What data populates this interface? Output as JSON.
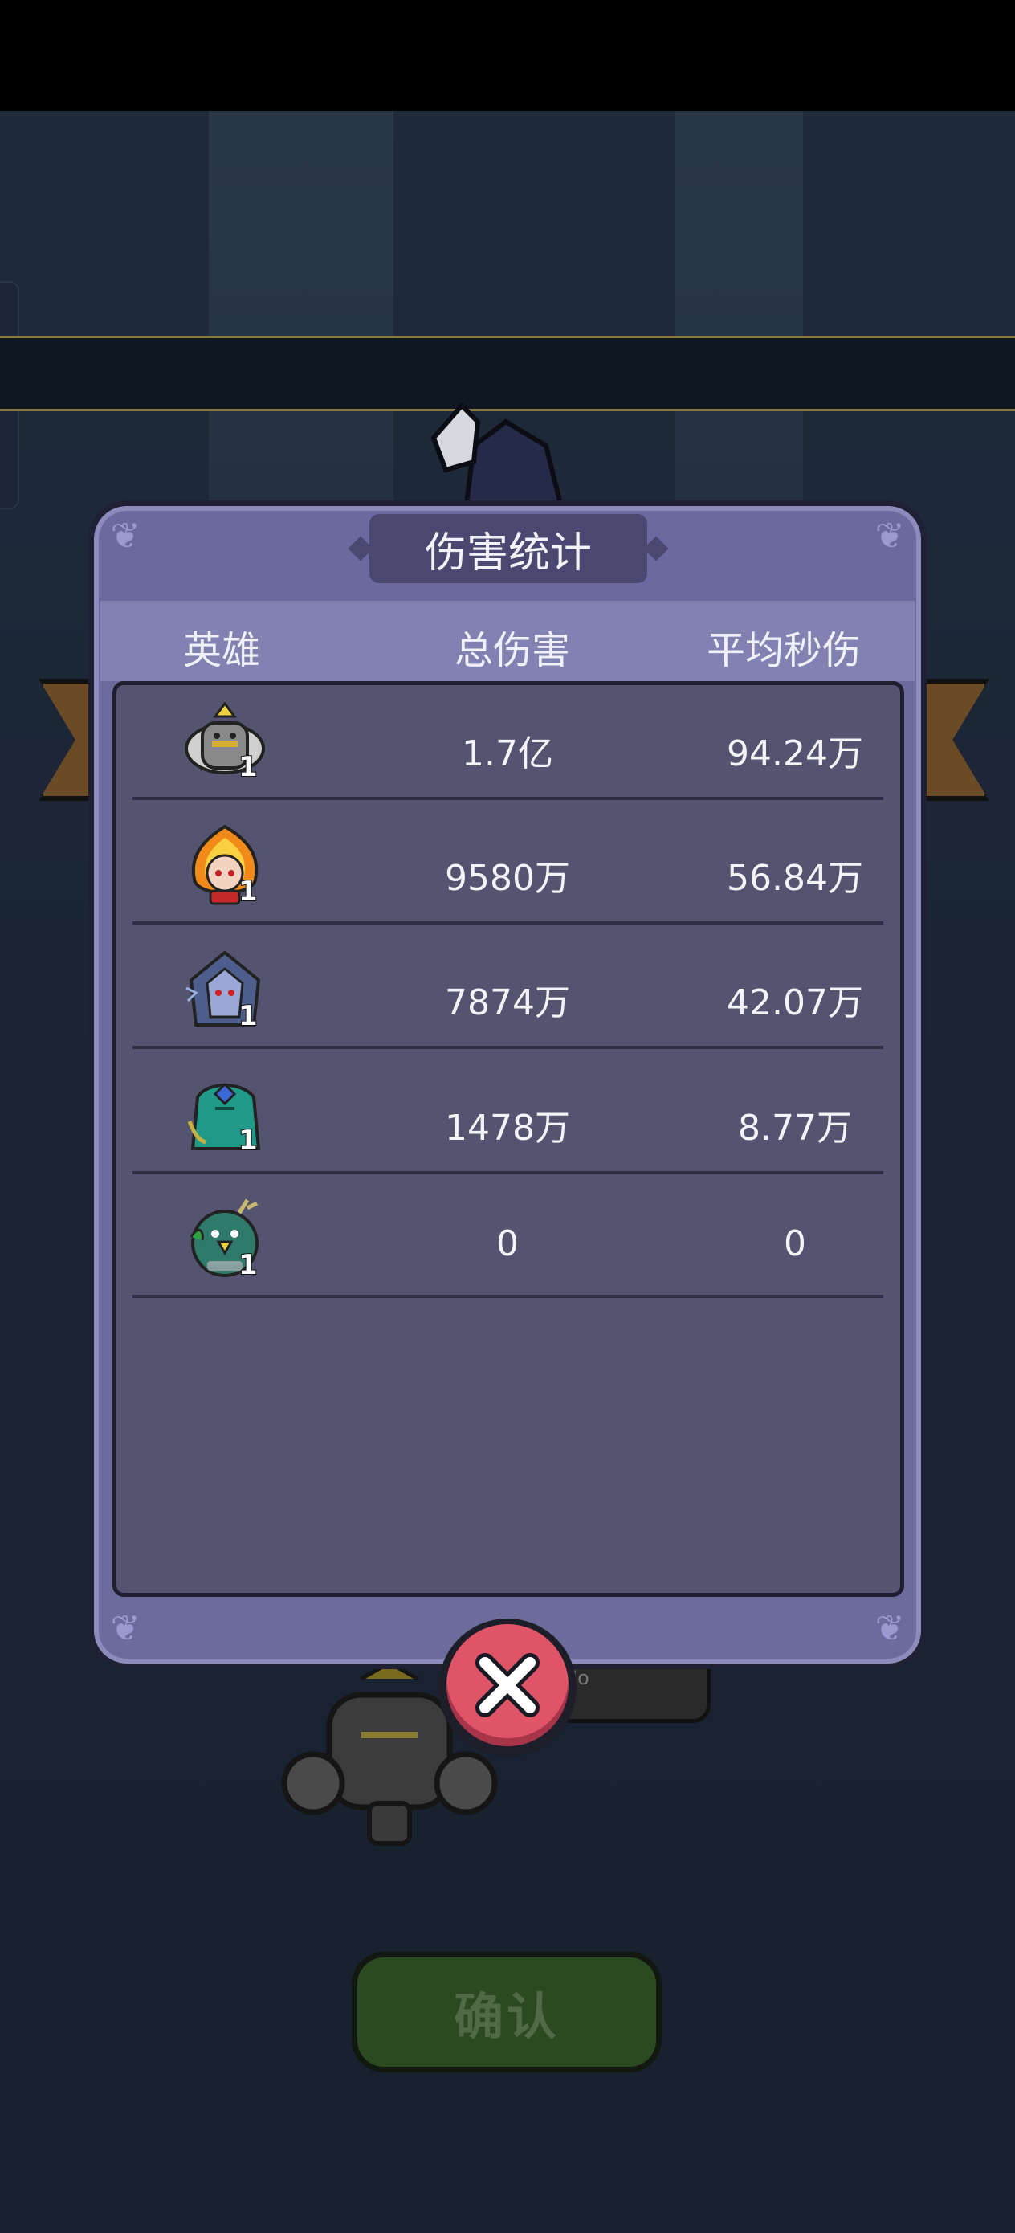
{
  "dialog": {
    "title": "伤害统计",
    "columns": {
      "hero": "英雄",
      "total_damage": "总伤害",
      "avg_dps": "平均秒伤"
    },
    "rows": [
      {
        "hero_icon": "stone-golem-hero-icon",
        "level": "1",
        "total_damage": "1.7亿",
        "avg_dps": "94.24万"
      },
      {
        "hero_icon": "fire-girl-hero-icon",
        "level": "1",
        "total_damage": "9580万",
        "avg_dps": "56.84万"
      },
      {
        "hero_icon": "hooded-assassin-hero-icon",
        "level": "1",
        "total_damage": "7874万",
        "avg_dps": "42.07万"
      },
      {
        "hero_icon": "teal-sea-spirit-hero-icon",
        "level": "1",
        "total_damage": "1478万",
        "avg_dps": "8.77万"
      },
      {
        "hero_icon": "deer-bird-hero-icon",
        "level": "1",
        "total_damage": "0",
        "avg_dps": "0"
      }
    ],
    "close_icon": "close-x-icon"
  },
  "background": {
    "confirm_button_label": "确认",
    "pill_text": "Jo"
  },
  "colors": {
    "panel": "#6c6c9c",
    "list_bg": "#545470",
    "close_button": "#e05468",
    "confirm_button": "#2c4a22"
  }
}
